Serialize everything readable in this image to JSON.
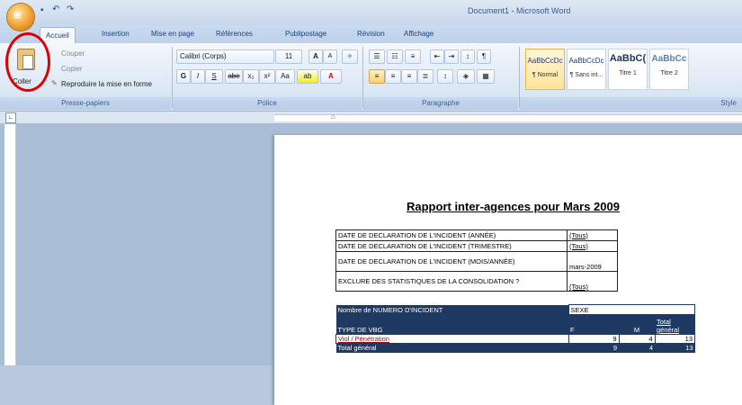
{
  "window": {
    "title": "Document1 - Microsoft Word"
  },
  "qat": {
    "undo": "↶",
    "redo": "↷"
  },
  "tabs": [
    {
      "label": "Accueil"
    },
    {
      "label": "Insertion"
    },
    {
      "label": "Mise en page"
    },
    {
      "label": "Références"
    },
    {
      "label": "Publipostage"
    },
    {
      "label": "Révision"
    },
    {
      "label": "Affichage"
    }
  ],
  "clipboard": {
    "paste": "Coller",
    "cut": "Couper",
    "copy": "Copier",
    "format_painter": "Reproduire la mise en forme",
    "group": "Presse-papiers"
  },
  "font": {
    "name": "Calibri (Corps)",
    "size": "11",
    "grow": "A",
    "shrink": "A",
    "bold": "G",
    "italic": "I",
    "underline": "S",
    "strike": "abe",
    "sub": "x₂",
    "sup": "x²",
    "case": "Aa",
    "group": "Police"
  },
  "paragraph": {
    "group": "Paragraphe",
    "pilcrow": "¶"
  },
  "styles": {
    "group": "Style",
    "items": [
      {
        "preview": "AaBbCcDc",
        "name": "¶ Normal"
      },
      {
        "preview": "AaBbCcDc",
        "name": "¶ Sans int..."
      },
      {
        "preview": "AaBbC(",
        "name": "Titre 1"
      },
      {
        "preview": "AaBbCc",
        "name": "Titre 2"
      }
    ]
  },
  "document": {
    "title": "Rapport inter-agences pour Mars 2009",
    "filters": [
      {
        "label": "DATE DE DECLARATION DE L'INCIDENT (ANNÉE)",
        "value": "(Tous)"
      },
      {
        "label": "DATE DE DECLARATION DE L'INCIDENT (TRIMESTRE)",
        "value": "(Tous)"
      },
      {
        "label": "DATE DE DECLARATION DE L'INCIDENT (MOIS/ANNÉE)",
        "value": "mars-2009"
      },
      {
        "label": "EXCLURE DES STATISTIQUES DE LA CONSOLIDATION ?",
        "value": "(Tous)"
      }
    ],
    "pivot": {
      "count_label": "Nombre de NUMERO D'INCIDENT",
      "col_header": "SEXE",
      "row_header": "TYPE DE VBG",
      "col_f": "F",
      "col_m": "M",
      "col_total": "Total général",
      "row_label": "Viol / Pénétration",
      "row_f": "9",
      "row_m": "4",
      "row_total": "13",
      "total_label": "Total général",
      "total_f": "9",
      "total_m": "4",
      "total_total": "13"
    }
  }
}
